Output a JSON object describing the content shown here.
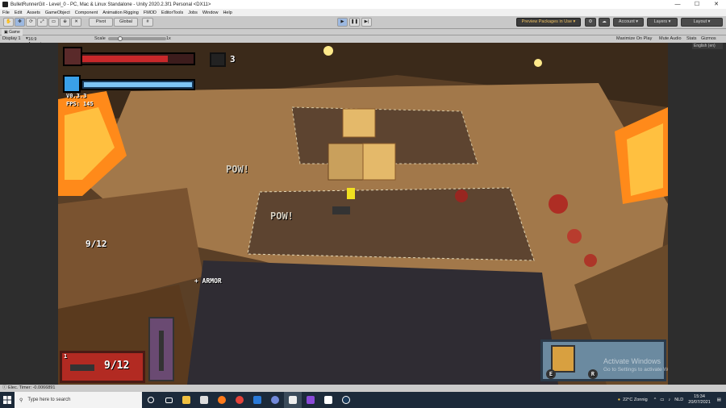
{
  "window": {
    "title": "BulletRunnerGit - Level_0 - PC, Mac & Linux Standalone - Unity 2020.2.3f1 Personal <DX11>",
    "minimize": "—",
    "maximize": "☐",
    "close": "✕"
  },
  "menu": [
    "File",
    "Edit",
    "Assets",
    "GameObject",
    "Component",
    "Animation Rigging",
    "FMOD",
    "EditorTools",
    "Jobs",
    "Window",
    "Help"
  ],
  "toolbar": {
    "pivot": "Pivot",
    "global": "Global",
    "preview_packages": "Preview Packages in Use ▾",
    "account": "Account",
    "layers": "Layers",
    "layout": "Layout"
  },
  "game_tab": {
    "label": "Game",
    "display": "Display 1",
    "aspect": "16:9 Aspect",
    "scale_label": "Scale",
    "scale_value": "1x",
    "maximize_on_play": "Maximize On Play",
    "mute_audio": "Mute Audio",
    "stats": "Stats",
    "gizmos": "Gizmos",
    "language": "English (en)"
  },
  "hud": {
    "health_fill": 0.8,
    "shield_fill": 1.0,
    "coins": "3",
    "version": "V0.3.3",
    "fps": "FPS: 145",
    "ammo_world": "9/12",
    "pow_1": "POW!",
    "pow_2": "POW!",
    "armor_pickup": "+ ARMOR",
    "weapon_slot_number": "1",
    "weapon_ammo": "9/12",
    "key_e": "E",
    "key_r": "R",
    "watermark_title": "Activate Windows",
    "watermark_sub": "Go to Settings to activate Windows."
  },
  "status": {
    "text": "Elec. Timer: -0.0066891"
  },
  "taskbar": {
    "search_placeholder": "Type here to search",
    "weather": "22°C  Zonnig",
    "language": "NLD",
    "time": "15:34",
    "date": "20/07/2021"
  },
  "colors": {
    "health": "#c8282a",
    "shield": "#3aa0e8",
    "lava": "#ff8a1a",
    "floor": "#a07a4a"
  }
}
